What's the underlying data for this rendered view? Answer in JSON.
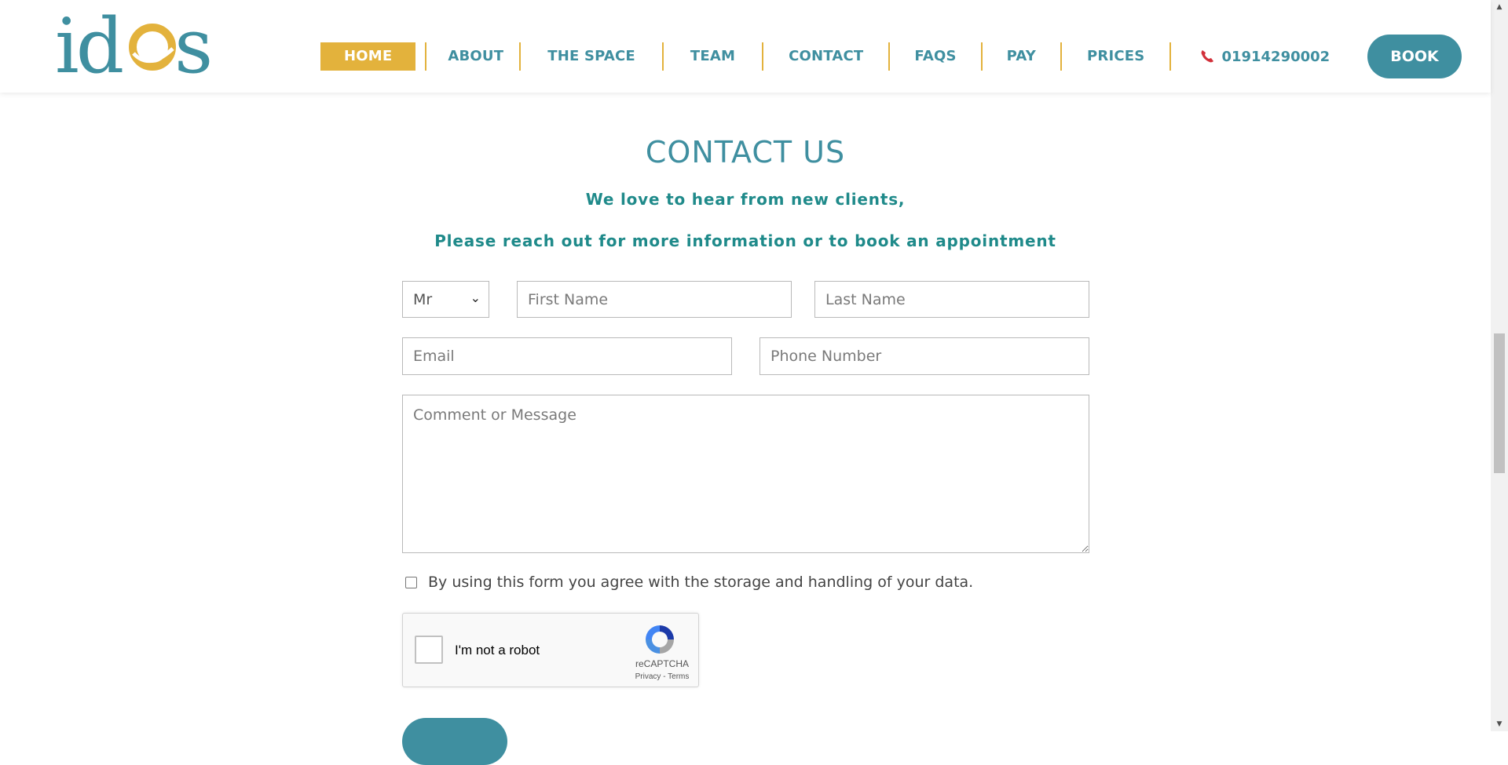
{
  "brand": {
    "logo_text": "idos",
    "colors": {
      "teal": "#3f8fa0",
      "gold": "#e3b23c",
      "heading_teal": "#1f8a8a"
    }
  },
  "nav": {
    "items": [
      {
        "label": "HOME",
        "active": true
      },
      {
        "label": "ABOUT"
      },
      {
        "label": "THE SPACE"
      },
      {
        "label": "TEAM"
      },
      {
        "label": "CONTACT"
      },
      {
        "label": "FAQS"
      },
      {
        "label": "PAY"
      },
      {
        "label": "PRICES"
      }
    ],
    "phone": "01914290002",
    "book_label": "BOOK"
  },
  "contact": {
    "title": "CONTACT US",
    "subtitle_1": "We love to hear from new clients,",
    "subtitle_2": "Please reach out for more information or to book an appointment"
  },
  "form": {
    "salutation_value": "Mr",
    "first_name_placeholder": "First Name",
    "last_name_placeholder": "Last Name",
    "email_placeholder": "Email",
    "phone_placeholder": "Phone Number",
    "message_placeholder": "Comment or Message",
    "agree_text": "By using this form you agree with the storage and handling of your data.",
    "agree_checked": false
  },
  "recaptcha": {
    "label": "I'm not a robot",
    "brand": "reCAPTCHA",
    "links": "Privacy - Terms"
  }
}
